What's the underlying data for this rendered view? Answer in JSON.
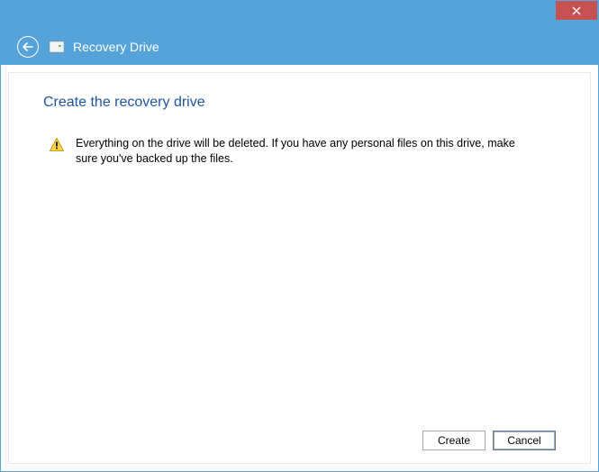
{
  "titlebar": {
    "close_tooltip": "Close"
  },
  "header": {
    "title": "Recovery Drive"
  },
  "page": {
    "heading": "Create the recovery drive",
    "warning_text": "Everything on the drive will be deleted. If you have any personal files on this drive, make sure you've backed up the files."
  },
  "buttons": {
    "create": "Create",
    "cancel": "Cancel"
  }
}
